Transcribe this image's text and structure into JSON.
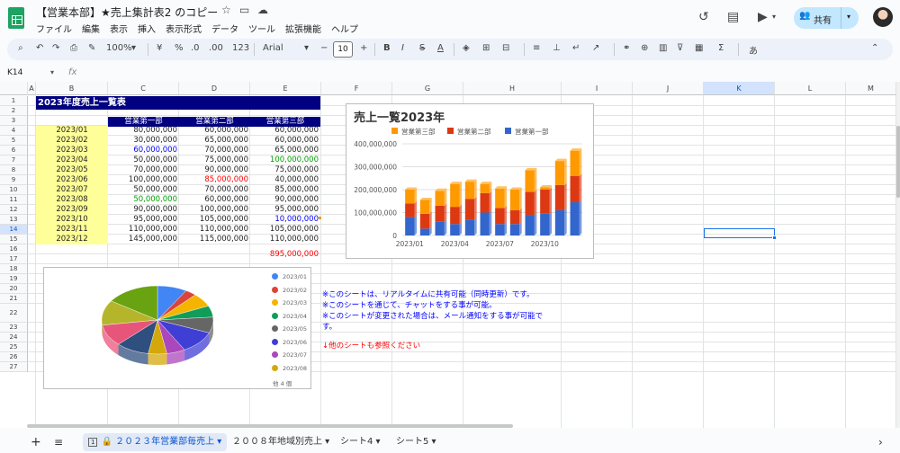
{
  "app": {
    "doc_title": "【営業本部】★売上集計表2 のコピー",
    "menu": [
      "ファイル",
      "編集",
      "表示",
      "挿入",
      "表示形式",
      "データ",
      "ツール",
      "拡張機能",
      "ヘルプ"
    ],
    "share_label": "共有",
    "icons": [
      "star-icon",
      "move-folder-icon",
      "cloud-status-icon",
      "history-icon",
      "comment-icon",
      "meet-icon",
      "people-icon"
    ]
  },
  "toolbar": {
    "zoom": "100%",
    "currency": "¥",
    "percent": "%",
    "dec_minus": ".0",
    "dec_plus": ".00",
    "format_123": "123",
    "font": "Arial",
    "font_size": "10",
    "bold": "B",
    "italic": "I",
    "strike": "S",
    "color_a": "A",
    "sigma": "Σ",
    "input_tool": "あ"
  },
  "formula": {
    "name_box": "K14",
    "fx": "fx",
    "content": ""
  },
  "columns": [
    "A",
    "B",
    "C",
    "D",
    "E",
    "F",
    "G",
    "H",
    "I",
    "J",
    "K",
    "L",
    "M"
  ],
  "rows": [
    "1",
    "2",
    "3",
    "4",
    "5",
    "6",
    "7",
    "8",
    "9",
    "10",
    "11",
    "12",
    "13",
    "14",
    "15",
    "16",
    "17",
    "18",
    "19",
    "20",
    "21",
    "22",
    "23",
    "24",
    "25",
    "26",
    "27"
  ],
  "table": {
    "title": "2023年度売上一覧表",
    "headers": [
      "営業第一部",
      "営業第二部",
      "営業第三部"
    ],
    "rows": [
      {
        "month": "2023/01",
        "v1": "80,000,000",
        "v2": "60,000,000",
        "v3": "60,000,000"
      },
      {
        "month": "2023/02",
        "v1": "30,000,000",
        "v2": "65,000,000",
        "v3": "60,000,000"
      },
      {
        "month": "2023/03",
        "v1": "60,000,000",
        "v2": "70,000,000",
        "v3": "65,000,000"
      },
      {
        "month": "2023/04",
        "v1": "50,000,000",
        "v2": "75,000,000",
        "v3": "100,000,000"
      },
      {
        "month": "2023/05",
        "v1": "70,000,000",
        "v2": "90,000,000",
        "v3": "75,000,000"
      },
      {
        "month": "2023/06",
        "v1": "100,000,000",
        "v2": "85,000,000",
        "v3": "40,000,000"
      },
      {
        "month": "2023/07",
        "v1": "50,000,000",
        "v2": "70,000,000",
        "v3": "85,000,000"
      },
      {
        "month": "2023/08",
        "v1": "50,000,000",
        "v2": "60,000,000",
        "v3": "90,000,000"
      },
      {
        "month": "2023/09",
        "v1": "90,000,000",
        "v2": "100,000,000",
        "v3": "95,000,000"
      },
      {
        "month": "2023/10",
        "v1": "95,000,000",
        "v2": "105,000,000",
        "v3": "10,000,000"
      },
      {
        "month": "2023/11",
        "v1": "110,000,000",
        "v2": "110,000,000",
        "v3": "105,000,000"
      },
      {
        "month": "2023/12",
        "v1": "145,000,000",
        "v2": "115,000,000",
        "v3": "110,000,000"
      }
    ],
    "total": "895,000,000",
    "colors": {
      "blue": "#0000ff",
      "green": "#00a000",
      "red": "#ff0000"
    }
  },
  "notes": {
    "line1": "※このシートは、リアルタイムに共有可能（同時更新）です。",
    "line2": "※このシートを通じて、チャットをする事が可能。",
    "line3": "※このシートが変更された場合は、メール通知をする事が可能で",
    "line4": "す。",
    "line5": "↓他のシートも参照ください"
  },
  "chart_data": [
    {
      "type": "bar",
      "stacked": true,
      "title": "売上一覧2023年",
      "categories": [
        "2023/01",
        "2023/02",
        "2023/03",
        "2023/04",
        "2023/05",
        "2023/06",
        "2023/07",
        "2023/08",
        "2023/09",
        "2023/10",
        "2023/11",
        "2023/12"
      ],
      "x_tick_labels": [
        "2023/01",
        "2023/04",
        "2023/07",
        "2023/10"
      ],
      "y_tick_labels": [
        "0",
        "100,000,000",
        "200,000,000",
        "300,000,000",
        "400,000,000"
      ],
      "ylim": [
        0,
        400000000
      ],
      "legend_position": "top",
      "series": [
        {
          "name": "営業第三部",
          "color": "#ff9900",
          "values": [
            60000000,
            60000000,
            65000000,
            100000000,
            75000000,
            40000000,
            85000000,
            90000000,
            95000000,
            10000000,
            105000000,
            110000000
          ]
        },
        {
          "name": "営業第二部",
          "color": "#dc3912",
          "values": [
            60000000,
            65000000,
            70000000,
            75000000,
            90000000,
            85000000,
            70000000,
            60000000,
            100000000,
            105000000,
            110000000,
            115000000
          ]
        },
        {
          "name": "営業第一部",
          "color": "#3366cc",
          "values": [
            80000000,
            30000000,
            60000000,
            50000000,
            70000000,
            100000000,
            50000000,
            50000000,
            90000000,
            95000000,
            110000000,
            145000000
          ]
        }
      ]
    },
    {
      "type": "pie",
      "categories": [
        "2023/01",
        "2023/02",
        "2023/03",
        "2023/04",
        "2023/05",
        "2023/06",
        "2023/07",
        "2023/08",
        "2023/09",
        "2023/10",
        "2023/11",
        "2023/12"
      ],
      "values": [
        80000000,
        30000000,
        60000000,
        50000000,
        70000000,
        100000000,
        50000000,
        50000000,
        90000000,
        95000000,
        110000000,
        145000000
      ],
      "colors": [
        "#4285f4",
        "#db4437",
        "#f4b400",
        "#0f9d58",
        "#666666",
        "#3f3fd6",
        "#ab47bc",
        "#d4a80a",
        "#2f4f7f",
        "#e8557a",
        "#b5b52c",
        "#6aa312"
      ],
      "legend_more": "他 4 個",
      "legend_position": "right"
    }
  ]
}
